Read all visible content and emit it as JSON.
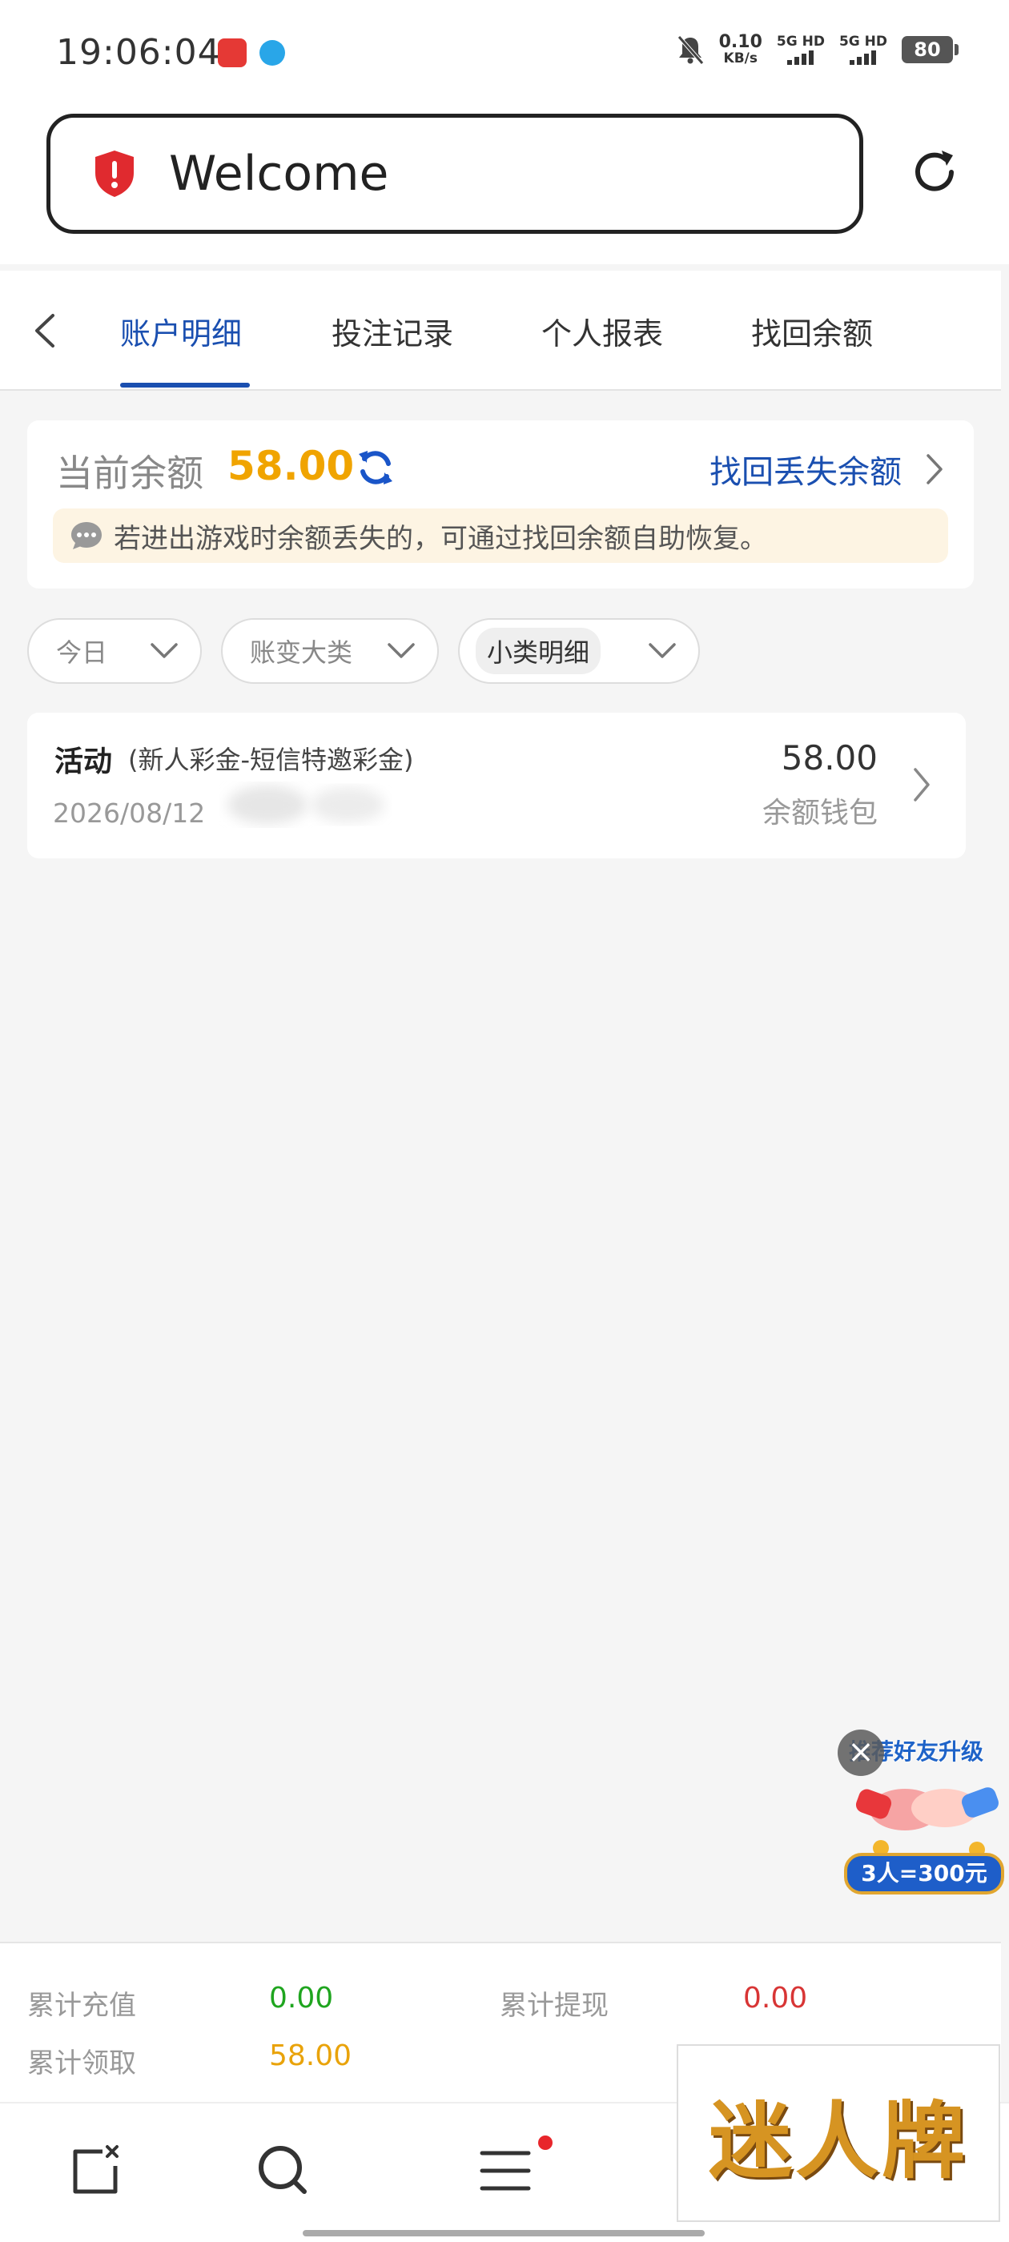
{
  "status_bar": {
    "time": "19:06:04",
    "net_speed_value": "0.10",
    "net_speed_unit": "KB/s",
    "sim1_label": "5G HD",
    "sim2_label": "5G HD",
    "battery": "80"
  },
  "address_bar": {
    "text": "Welcome"
  },
  "tabs": [
    {
      "label": "账户明细",
      "active": true
    },
    {
      "label": "投注记录",
      "active": false
    },
    {
      "label": "个人报表",
      "active": false
    },
    {
      "label": "找回余额",
      "active": false
    }
  ],
  "balance": {
    "label": "当前余额",
    "value": "58.00",
    "recover_link": "找回丢失余额",
    "notice": "若进出游戏时余额丢失的，可通过找回余额自助恢复。"
  },
  "filters": [
    {
      "label": "今日"
    },
    {
      "label": "账变大类"
    },
    {
      "label": "小类明细"
    }
  ],
  "transactions": [
    {
      "type": "活动",
      "detail": "(新人彩金-短信特邀彩金)",
      "date": "2026/08/12",
      "amount": "58.00",
      "wallet": "余额钱包"
    }
  ],
  "promo": {
    "title": "推荐好友升级",
    "banner": "3人=300元"
  },
  "summary": {
    "total_deposit_label": "累计充值",
    "total_deposit_value": "0.00",
    "total_withdraw_label": "累计提现",
    "total_withdraw_value": "0.00",
    "total_claim_label": "累计领取",
    "total_claim_value": "58.00"
  },
  "bottom_nav": {
    "logo_text": "迷人牌"
  },
  "colors": {
    "accent_blue": "#1a4fb0",
    "balance_orange": "#f0a400",
    "green": "#1fa51f",
    "red": "#d83535"
  }
}
